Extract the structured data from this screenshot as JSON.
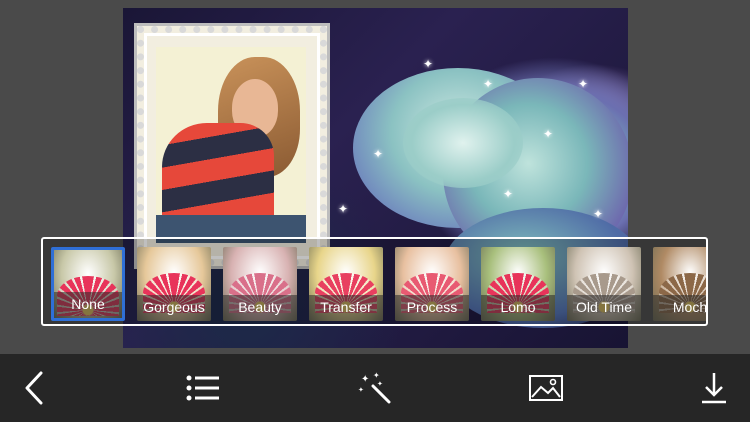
{
  "filters": [
    {
      "label": "None",
      "selected": true,
      "tint": "#c8c8a8",
      "petal": "#e8345a"
    },
    {
      "label": "Gorgeous",
      "selected": false,
      "tint": "#e6c89a",
      "petal": "#e8345a"
    },
    {
      "label": "Beauty",
      "selected": false,
      "tint": "#d8b2b2",
      "petal": "#d9708a"
    },
    {
      "label": "Transfer",
      "selected": false,
      "tint": "#e8d58a",
      "petal": "#e84060"
    },
    {
      "label": "Process",
      "selected": false,
      "tint": "#e8c0a0",
      "petal": "#e85a72"
    },
    {
      "label": "Lomo",
      "selected": false,
      "tint": "#a8bf7c",
      "petal": "#e8345a"
    },
    {
      "label": "Old Time",
      "selected": false,
      "tint": "#cfc3b4",
      "petal": "#a89a8c"
    },
    {
      "label": "Moch",
      "selected": false,
      "tint": "#b08a64",
      "petal": "#8c6848"
    }
  ],
  "colors": {
    "selected_border": "#2f6fd6",
    "toolbar_bg": "#262626",
    "page_bg": "#4a4a4a"
  },
  "toolbar": {
    "icons": [
      "back-chevron-icon",
      "list-icon",
      "magic-wand-icon",
      "image-icon",
      "download-icon"
    ]
  }
}
